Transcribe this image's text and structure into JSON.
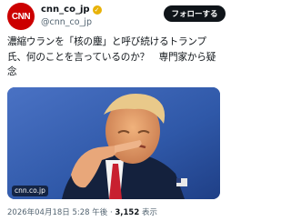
{
  "author": {
    "avatar_logo": "CNN",
    "display_name": "cnn_co_jp",
    "handle": "@cnn_co_jp",
    "verified_badge_color": "#e8b208"
  },
  "follow_button_label": "フォローする",
  "tweet": {
    "text": "濃縮ウランを「核の塵」と呼び続けるトランプ氏、何のことを言っているのか？　専門家から疑念"
  },
  "media": {
    "source_badge": "cnn.co.jp"
  },
  "meta": {
    "timestamp": "2026年04月18日 5:28 午後",
    "separator": " · ",
    "views_count": "3,152",
    "views_label": " 表示"
  },
  "colors": {
    "brand_red": "#cc0000",
    "text": "#0f1419",
    "secondary": "#536471"
  }
}
